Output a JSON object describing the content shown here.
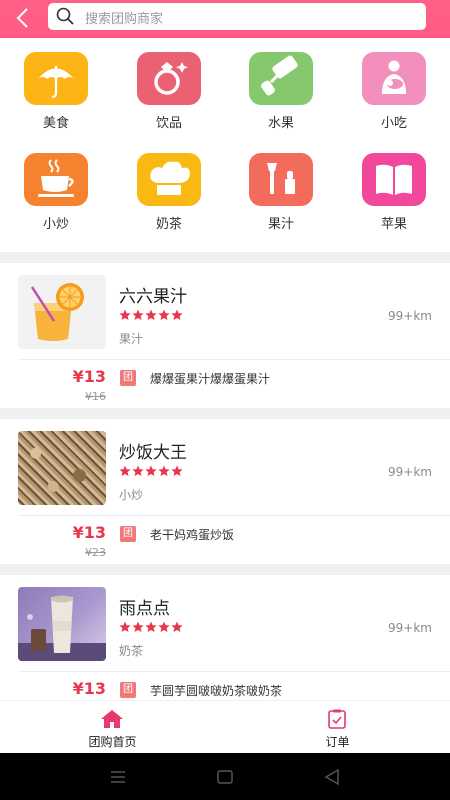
{
  "header": {
    "search_placeholder": "搜索团购商家"
  },
  "categories": [
    {
      "label": "美食",
      "icon": "umbrella-icon",
      "color": "#fcb514"
    },
    {
      "label": "饮品",
      "icon": "ring-icon",
      "color": "#ea6173"
    },
    {
      "label": "水果",
      "icon": "paint-roller-icon",
      "color": "#86c86e"
    },
    {
      "label": "小吃",
      "icon": "mother-baby-icon",
      "color": "#f28fbc"
    },
    {
      "label": "小炒",
      "icon": "coffee-cup-icon",
      "color": "#f5822e"
    },
    {
      "label": "奶茶",
      "icon": "chef-hat-icon",
      "color": "#fab813"
    },
    {
      "label": "果汁",
      "icon": "makeup-icon",
      "color": "#f26b5b"
    },
    {
      "label": "苹果",
      "icon": "book-icon",
      "color": "#f2489b"
    }
  ],
  "stores": [
    {
      "name": "六六果汁",
      "rating": 5,
      "distance": "99+km",
      "category": "果汁",
      "price": "¥13",
      "original_price": "¥16",
      "tag": "团",
      "deal": "爆爆蛋果汁爆爆蛋果汁"
    },
    {
      "name": "炒饭大王",
      "rating": 5,
      "distance": "99+km",
      "category": "小炒",
      "price": "¥13",
      "original_price": "¥23",
      "tag": "团",
      "deal": "老干妈鸡蛋炒饭"
    },
    {
      "name": "雨点点",
      "rating": 5,
      "distance": "99+km",
      "category": "奶茶",
      "price": "¥13",
      "original_price": "",
      "tag": "团",
      "deal": "芋圆芋圆啵啵奶茶啵奶茶"
    }
  ],
  "tabbar": {
    "home_label": "团购首页",
    "orders_label": "订单"
  },
  "colors": {
    "brand": "#ff5c83",
    "price": "#e8374c",
    "star": "#e8374c"
  }
}
